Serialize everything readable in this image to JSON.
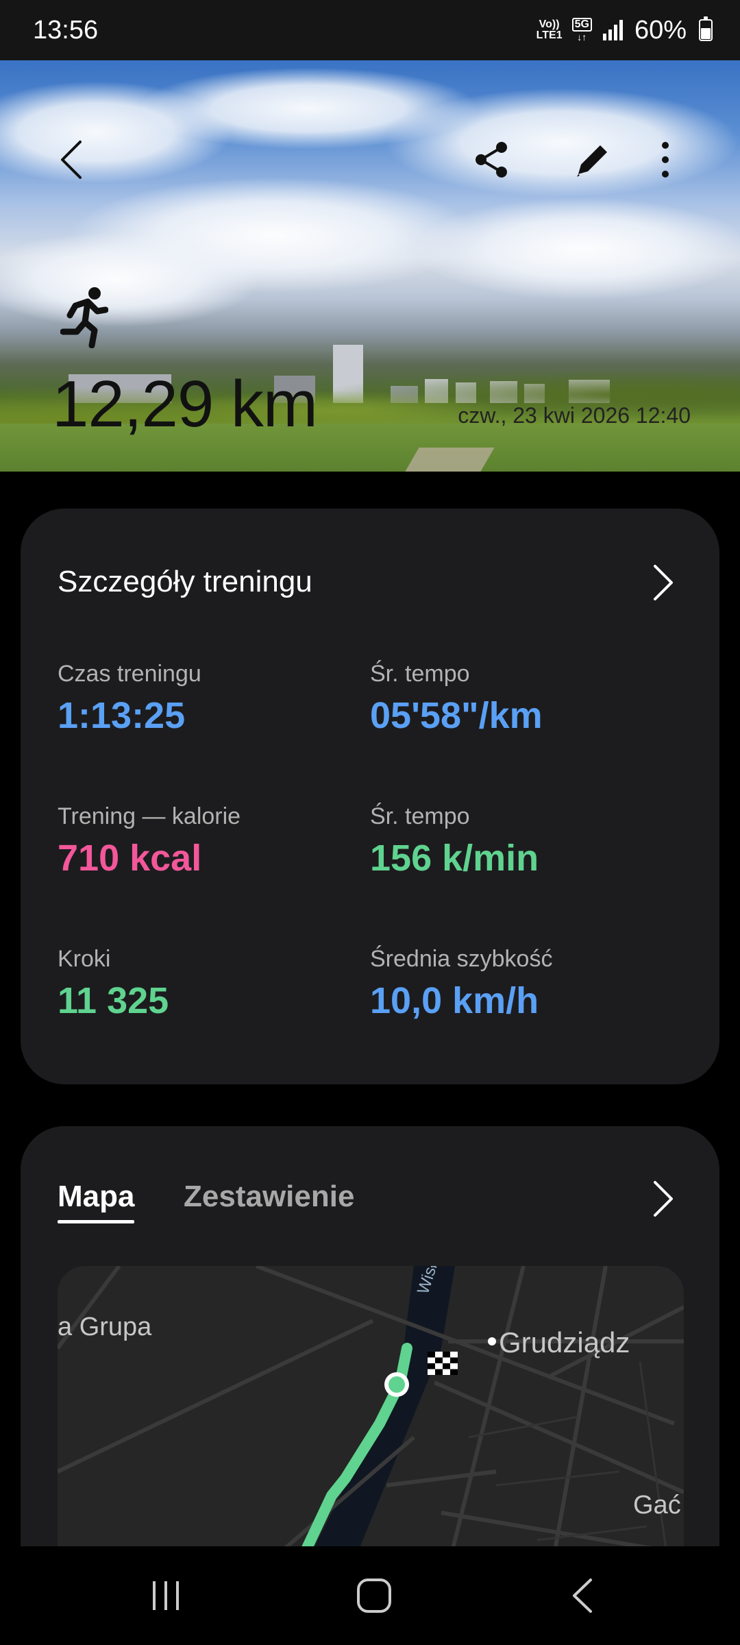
{
  "status_bar": {
    "time": "13:56",
    "network_top": "Vo))",
    "network_bottom": "LTE1",
    "network_5g": "5G",
    "battery": "60%",
    "battery_level": 0.6
  },
  "hero": {
    "distance": "12,29 km",
    "date": "czw., 23 kwi 2026 12:40",
    "icons": {
      "back": "back-arrow-icon",
      "share": "share-icon",
      "edit": "pencil-icon",
      "more": "more-vertical-icon",
      "activity": "running-icon"
    }
  },
  "details": {
    "title": "Szczegóły treningu",
    "stats": [
      {
        "label": "Czas treningu",
        "value": "1:13:25",
        "color": "#5aa0f5"
      },
      {
        "label": "Śr. tempo",
        "value": "05'58\"/km",
        "color": "#5aa0f5"
      },
      {
        "label": "Trening — kalorie",
        "value": "710 kcal",
        "color": "#f3579a"
      },
      {
        "label": "Śr. tempo",
        "value": "156 k/min",
        "color": "#5fd38f"
      },
      {
        "label": "Kroki",
        "value": "11 325",
        "color": "#5fd38f"
      },
      {
        "label": "Średnia szybkość",
        "value": "10,0 km/h",
        "color": "#5aa0f5"
      }
    ]
  },
  "map_card": {
    "tabs": [
      {
        "label": "Mapa",
        "active": true
      },
      {
        "label": "Zestawienie",
        "active": false
      }
    ],
    "labels": {
      "left": "a Grupa",
      "river": "Wisła",
      "city": "Grudziądz",
      "corner": "Gać"
    },
    "route_color": "#5fd38f"
  },
  "navbar": {
    "icons": [
      "recent-apps-icon",
      "home-icon",
      "back-icon"
    ]
  }
}
